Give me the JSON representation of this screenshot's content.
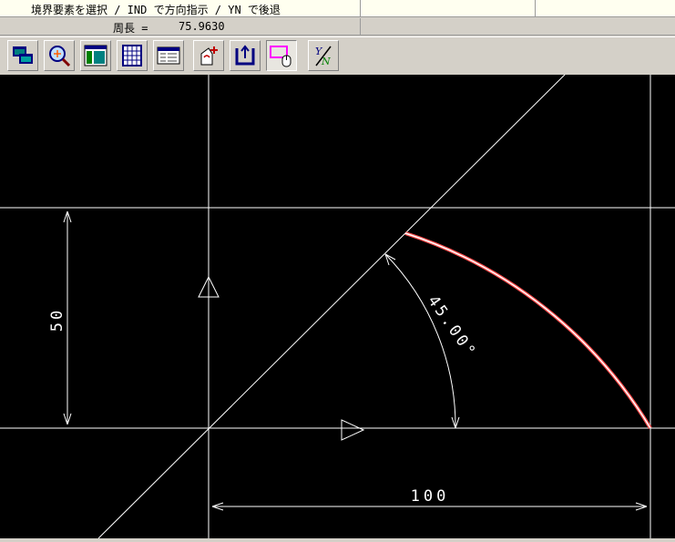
{
  "status": {
    "prompt": "境界要素を選択 / IND で方向指示 / YN で後退",
    "perimeter_label": "周長 =",
    "perimeter_value": "75.9630"
  },
  "toolbar": {
    "buttons": [
      {
        "name": "window-switch-icon"
      },
      {
        "name": "zoom-icon"
      },
      {
        "name": "layout-panels-icon"
      },
      {
        "name": "grid-table-icon"
      },
      {
        "name": "list-window-icon"
      },
      {
        "name": "add-element-icon"
      },
      {
        "name": "boundary-select-icon"
      },
      {
        "name": "pick-with-mouse-icon",
        "pressed": true
      },
      {
        "name": "yes-no-icon"
      }
    ]
  },
  "drawing": {
    "dim_vertical": "50",
    "dim_horizontal": "100",
    "dim_angle": "45.00°"
  },
  "colors": {
    "background": "#000000",
    "lines": "#ffffff",
    "selected_arc": "#ff5050"
  }
}
